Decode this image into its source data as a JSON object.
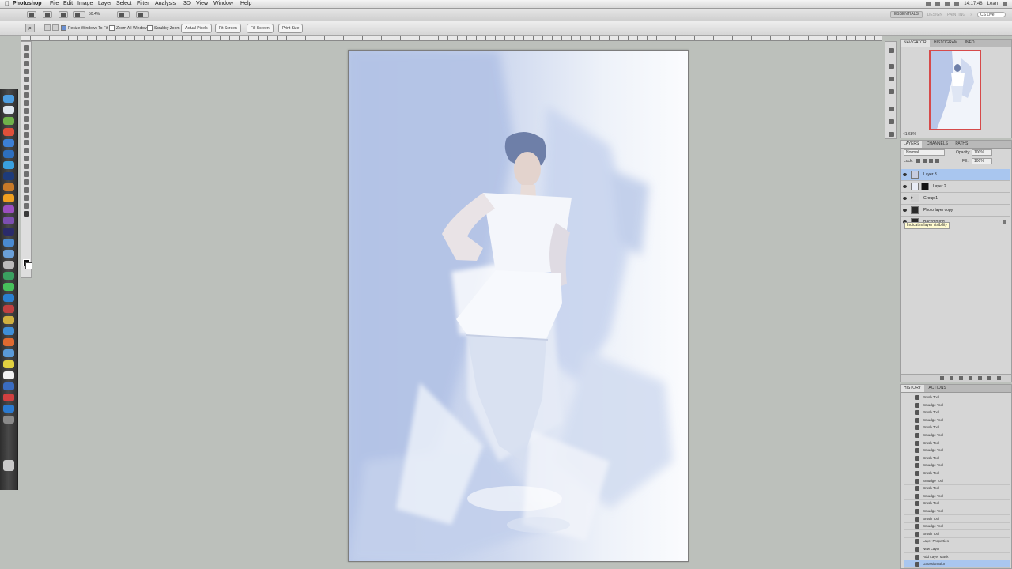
{
  "menubar": {
    "app_name": "Photoshop",
    "items": [
      "File",
      "Edit",
      "Image",
      "Layer",
      "Select",
      "Filter",
      "Analysis",
      "3D",
      "View",
      "Window",
      "Help"
    ],
    "clock": "14:17:48",
    "user": "Lean",
    "workspaces": [
      "ESSENTIALS",
      "DESIGN",
      "PAINTING"
    ],
    "search_placeholder": "CS Live"
  },
  "appbar": {
    "zoom_level": "50.4%"
  },
  "options_bar": {
    "checkboxes": [
      {
        "label": "Resize Windows To Fit",
        "checked": true
      },
      {
        "label": "Zoom All Windows",
        "checked": false
      },
      {
        "label": "Scrubby Zoom",
        "checked": false
      }
    ],
    "buttons": [
      "Actual Pixels",
      "Fit Screen",
      "Fill Screen",
      "Print Size"
    ]
  },
  "navigator": {
    "tabs": [
      "NAVIGATOR",
      "HISTOGRAM",
      "INFO"
    ],
    "zoom": "41.68%"
  },
  "layers_panel": {
    "tabs": [
      "LAYERS",
      "CHANNELS",
      "PATHS"
    ],
    "blend_mode": "Normal",
    "opacity_label": "Opacity:",
    "opacity": "100%",
    "lock_label": "Lock:",
    "fill_label": "Fill:",
    "fill": "100%",
    "layers": [
      {
        "name": "Layer 3",
        "selected": true,
        "mask": false,
        "thumb": "#c7cde0"
      },
      {
        "name": "Layer 2",
        "selected": false,
        "mask": true,
        "thumb": "#e8ecf5"
      },
      {
        "name": "Group 1",
        "selected": false,
        "mask": false,
        "thumb": "#cfcfcf"
      },
      {
        "name": "Photo layer copy",
        "selected": false,
        "mask": false,
        "thumb": "#2a2a2a"
      },
      {
        "name": "Background",
        "selected": false,
        "mask": false,
        "thumb": "#2a2a2a"
      }
    ],
    "tooltip": "Indicates layer visibility"
  },
  "history_panel": {
    "tabs": [
      "HISTORY",
      "ACTIONS"
    ],
    "items": [
      "Brush Tool",
      "Smudge Tool",
      "Brush Tool",
      "Smudge Tool",
      "Brush Tool",
      "Smudge Tool",
      "Brush Tool",
      "Smudge Tool",
      "Brush Tool",
      "Smudge Tool",
      "Brush Tool",
      "Smudge Tool",
      "Brush Tool",
      "Smudge Tool",
      "Brush Tool",
      "Smudge Tool",
      "Brush Tool",
      "Smudge Tool",
      "Brush Tool",
      "Layer Properties",
      "New Layer",
      "Add Layer Mask",
      "Gaussian Blur"
    ],
    "selected_index": 22
  },
  "colors": {
    "canvas_bg": "#bcc0bb",
    "selection": "#a9c6ef",
    "painting_blue": "#b8c7e8"
  }
}
